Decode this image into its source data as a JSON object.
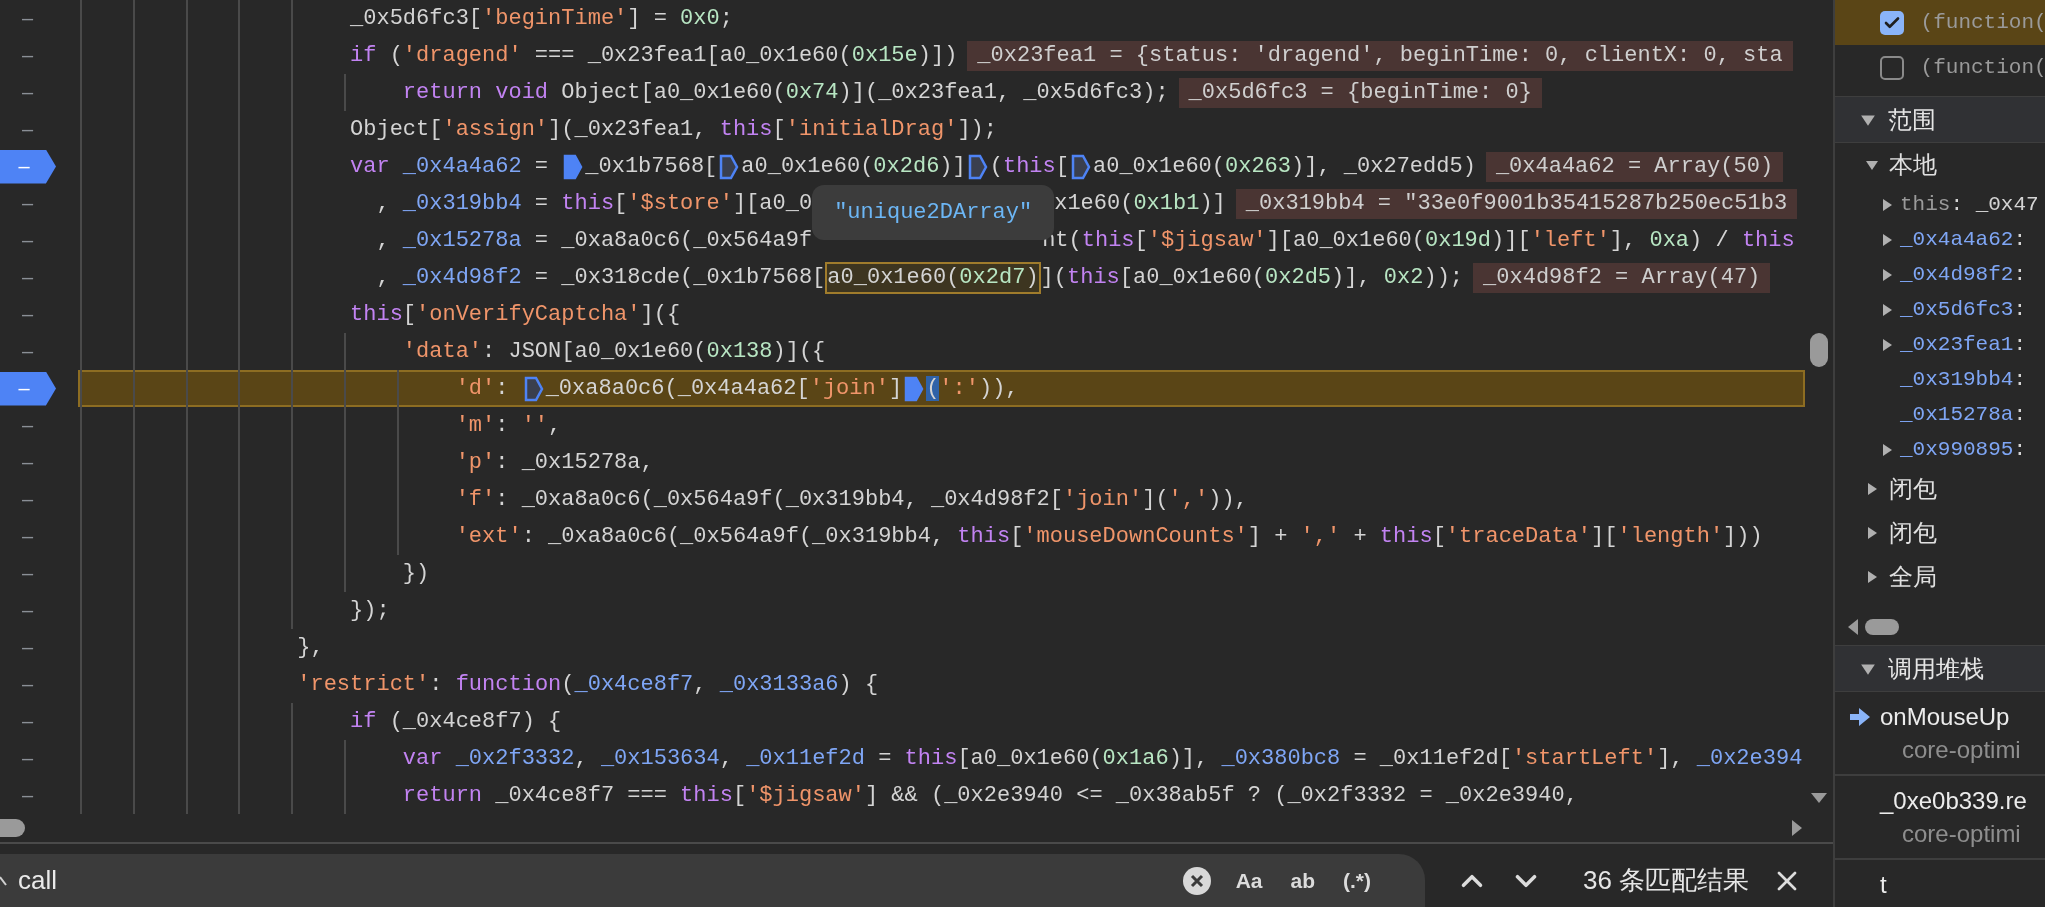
{
  "editor": {
    "lines": [
      {
        "gutter": "–",
        "breakpoint": false,
        "current": false,
        "segments": [
          {
            "kind": "plain",
            "text": "                    _0x5d6fc3["
          },
          {
            "kind": "string",
            "text": "'beginTime'"
          },
          {
            "kind": "plain",
            "text": "] = "
          },
          {
            "kind": "number",
            "text": "0x0"
          },
          {
            "kind": "plain",
            "text": ";"
          }
        ]
      },
      {
        "gutter": "–",
        "breakpoint": false,
        "current": false,
        "segments": [
          {
            "kind": "keyword",
            "text": "                    if"
          },
          {
            "kind": "plain",
            "text": " ("
          },
          {
            "kind": "string",
            "text": "'dragend'"
          },
          {
            "kind": "plain",
            "text": " === _0x23fea1[a0_0x1e60("
          },
          {
            "kind": "number",
            "text": "0x15e"
          },
          {
            "kind": "plain",
            "text": ")])"
          },
          {
            "kind": "value",
            "text": "_0x23fea1 = {status: 'dragend', beginTime: 0, clientX: 0, sta"
          }
        ]
      },
      {
        "gutter": "–",
        "breakpoint": false,
        "current": false,
        "segments": [
          {
            "kind": "keyword",
            "text": "                        return void"
          },
          {
            "kind": "plain",
            "text": " Object[a0_0x1e60("
          },
          {
            "kind": "number",
            "text": "0x74"
          },
          {
            "kind": "plain",
            "text": ")](_0x23fea1, _0x5d6fc3);"
          },
          {
            "kind": "value",
            "text": "_0x5d6fc3 = {beginTime: 0}"
          }
        ]
      },
      {
        "gutter": "–",
        "breakpoint": false,
        "current": false,
        "segments": [
          {
            "kind": "plain",
            "text": "                    Object["
          },
          {
            "kind": "string",
            "text": "'assign'"
          },
          {
            "kind": "plain",
            "text": "](_0x23fea1, "
          },
          {
            "kind": "keyword",
            "text": "this"
          },
          {
            "kind": "plain",
            "text": "["
          },
          {
            "kind": "string",
            "text": "'initialDrag'"
          },
          {
            "kind": "plain",
            "text": "]);"
          }
        ]
      },
      {
        "gutter": "–",
        "breakpoint": true,
        "current": false,
        "segments": [
          {
            "kind": "keyword",
            "text": "                    var "
          },
          {
            "kind": "variable",
            "text": "_0x4a4a62"
          },
          {
            "kind": "plain",
            "text": " = "
          },
          {
            "kind": "marker",
            "filled": true
          },
          {
            "kind": "plain",
            "text": "_0x1b7568["
          },
          {
            "kind": "marker",
            "filled": false
          },
          {
            "kind": "plain",
            "text": "a0_0x1e60("
          },
          {
            "kind": "number",
            "text": "0x2d6"
          },
          {
            "kind": "plain",
            "text": ")]"
          },
          {
            "kind": "marker",
            "filled": false
          },
          {
            "kind": "plain",
            "text": "("
          },
          {
            "kind": "keyword",
            "text": "this"
          },
          {
            "kind": "plain",
            "text": "["
          },
          {
            "kind": "marker",
            "filled": false
          },
          {
            "kind": "plain",
            "text": "a0_0x1e60("
          },
          {
            "kind": "number",
            "text": "0x263"
          },
          {
            "kind": "plain",
            "text": ")], _0x27edd5)"
          },
          {
            "kind": "value",
            "text": "_0x4a4a62 = Array(50)"
          }
        ]
      },
      {
        "gutter": "–",
        "breakpoint": false,
        "current": false,
        "segments": [
          {
            "kind": "plain",
            "text": "                      , "
          },
          {
            "kind": "variable",
            "text": "_0x319bb4"
          },
          {
            "kind": "plain",
            "text": " = "
          },
          {
            "kind": "keyword",
            "text": "this"
          },
          {
            "kind": "plain",
            "text": "["
          },
          {
            "kind": "string",
            "text": "'$store'"
          },
          {
            "kind": "plain",
            "text": "][a0_0"
          },
          {
            "kind": "tooltip",
            "text": "\"unique2DArray\""
          },
          {
            "kind": "plain",
            "text": "x1e60("
          },
          {
            "kind": "number",
            "text": "0x1b1"
          },
          {
            "kind": "plain",
            "text": ")]"
          },
          {
            "kind": "value",
            "text": "_0x319bb4 = \"33e0f9001b35415287b250ec51b3"
          }
        ]
      },
      {
        "gutter": "–",
        "breakpoint": false,
        "current": false,
        "segments": [
          {
            "kind": "plain",
            "text": "                      , "
          },
          {
            "kind": "variable",
            "text": "_0x15278a"
          },
          {
            "kind": "plain",
            "text": " = _0xa8a0c6(_0x564a9f"
          },
          {
            "kind": "covered"
          },
          {
            "kind": "plain",
            "text": "nt("
          },
          {
            "kind": "keyword",
            "text": "this"
          },
          {
            "kind": "plain",
            "text": "["
          },
          {
            "kind": "string",
            "text": "'$jigsaw'"
          },
          {
            "kind": "plain",
            "text": "][a0_0x1e60("
          },
          {
            "kind": "number",
            "text": "0x19d"
          },
          {
            "kind": "plain",
            "text": ")]["
          },
          {
            "kind": "string",
            "text": "'left'"
          },
          {
            "kind": "plain",
            "text": "], "
          },
          {
            "kind": "number",
            "text": "0xa"
          },
          {
            "kind": "plain",
            "text": ") / "
          },
          {
            "kind": "keyword",
            "text": "this"
          }
        ]
      },
      {
        "gutter": "–",
        "breakpoint": false,
        "current": false,
        "segments": [
          {
            "kind": "plain",
            "text": "                      , "
          },
          {
            "kind": "variable",
            "text": "_0x4d98f2"
          },
          {
            "kind": "plain",
            "text": " = _0x318cde(_0x1b7568["
          },
          {
            "kind": "hover",
            "tokens": [
              {
                "kind": "plain",
                "text": "a0_0x1e60("
              },
              {
                "kind": "number",
                "text": "0x2d7"
              },
              {
                "kind": "plain",
                "text": ")"
              }
            ]
          },
          {
            "kind": "plain",
            "text": "]("
          },
          {
            "kind": "keyword",
            "text": "this"
          },
          {
            "kind": "plain",
            "text": "[a0_0x1e60("
          },
          {
            "kind": "number",
            "text": "0x2d5"
          },
          {
            "kind": "plain",
            "text": ")], "
          },
          {
            "kind": "number",
            "text": "0x2"
          },
          {
            "kind": "plain",
            "text": "));"
          },
          {
            "kind": "value",
            "text": "_0x4d98f2 = Array(47)"
          }
        ]
      },
      {
        "gutter": "–",
        "breakpoint": false,
        "current": false,
        "segments": [
          {
            "kind": "keyword",
            "text": "                    this"
          },
          {
            "kind": "plain",
            "text": "["
          },
          {
            "kind": "string",
            "text": "'onVerifyCaptcha'"
          },
          {
            "kind": "plain",
            "text": "]({"
          }
        ]
      },
      {
        "gutter": "–",
        "breakpoint": false,
        "current": false,
        "segments": [
          {
            "kind": "string",
            "text": "                        'data'"
          },
          {
            "kind": "plain",
            "text": ": JSON[a0_0x1e60("
          },
          {
            "kind": "number",
            "text": "0x138"
          },
          {
            "kind": "plain",
            "text": ")]({"
          }
        ]
      },
      {
        "gutter": "–",
        "breakpoint": true,
        "current": true,
        "segments": [
          {
            "kind": "string",
            "text": "                            'd'"
          },
          {
            "kind": "plain",
            "text": ": "
          },
          {
            "kind": "marker",
            "filled": false
          },
          {
            "kind": "plain",
            "text": "_0xa8a0c6(_0x4a4a62["
          },
          {
            "kind": "string",
            "text": "'join'"
          },
          {
            "kind": "plain",
            "text": "]"
          },
          {
            "kind": "marker",
            "filled": true
          },
          {
            "kind": "plain",
            "text": "(",
            "highlight": true
          },
          {
            "kind": "string",
            "text": "':'"
          },
          {
            "kind": "plain",
            "text": ")),"
          }
        ]
      },
      {
        "gutter": "–",
        "breakpoint": false,
        "current": false,
        "segments": [
          {
            "kind": "string",
            "text": "                            'm'"
          },
          {
            "kind": "plain",
            "text": ": "
          },
          {
            "kind": "string",
            "text": "''"
          },
          {
            "kind": "plain",
            "text": ","
          }
        ]
      },
      {
        "gutter": "–",
        "breakpoint": false,
        "current": false,
        "segments": [
          {
            "kind": "string",
            "text": "                            'p'"
          },
          {
            "kind": "plain",
            "text": ": _0x15278a,"
          }
        ]
      },
      {
        "gutter": "–",
        "breakpoint": false,
        "current": false,
        "segments": [
          {
            "kind": "string",
            "text": "                            'f'"
          },
          {
            "kind": "plain",
            "text": ": _0xa8a0c6(_0x564a9f(_0x319bb4, _0x4d98f2["
          },
          {
            "kind": "string",
            "text": "'join'"
          },
          {
            "kind": "plain",
            "text": "]("
          },
          {
            "kind": "string",
            "text": "','"
          },
          {
            "kind": "plain",
            "text": ")),"
          }
        ]
      },
      {
        "gutter": "–",
        "breakpoint": false,
        "current": false,
        "segments": [
          {
            "kind": "string",
            "text": "                            'ext'"
          },
          {
            "kind": "plain",
            "text": ": _0xa8a0c6(_0x564a9f(_0x319bb4, "
          },
          {
            "kind": "keyword",
            "text": "this"
          },
          {
            "kind": "plain",
            "text": "["
          },
          {
            "kind": "string",
            "text": "'mouseDownCounts'"
          },
          {
            "kind": "plain",
            "text": "] + "
          },
          {
            "kind": "string",
            "text": "','"
          },
          {
            "kind": "plain",
            "text": " + "
          },
          {
            "kind": "keyword",
            "text": "this"
          },
          {
            "kind": "plain",
            "text": "["
          },
          {
            "kind": "string",
            "text": "'traceData'"
          },
          {
            "kind": "plain",
            "text": "]["
          },
          {
            "kind": "string",
            "text": "'length'"
          },
          {
            "kind": "plain",
            "text": "]))"
          }
        ]
      },
      {
        "gutter": "–",
        "breakpoint": false,
        "current": false,
        "segments": [
          {
            "kind": "plain",
            "text": "                        })"
          }
        ]
      },
      {
        "gutter": "–",
        "breakpoint": false,
        "current": false,
        "segments": [
          {
            "kind": "plain",
            "text": "                    });"
          }
        ]
      },
      {
        "gutter": "–",
        "breakpoint": false,
        "current": false,
        "segments": [
          {
            "kind": "plain",
            "text": "                },"
          }
        ]
      },
      {
        "gutter": "–",
        "breakpoint": false,
        "current": false,
        "segments": [
          {
            "kind": "string",
            "text": "                'restrict'"
          },
          {
            "kind": "plain",
            "text": ": "
          },
          {
            "kind": "keyword",
            "text": "function"
          },
          {
            "kind": "plain",
            "text": "("
          },
          {
            "kind": "variable",
            "text": "_0x4ce8f7"
          },
          {
            "kind": "plain",
            "text": ", "
          },
          {
            "kind": "variable",
            "text": "_0x3133a6"
          },
          {
            "kind": "plain",
            "text": ") {"
          }
        ]
      },
      {
        "gutter": "–",
        "breakpoint": false,
        "current": false,
        "segments": [
          {
            "kind": "keyword",
            "text": "                    if"
          },
          {
            "kind": "plain",
            "text": " (_0x4ce8f7) {"
          }
        ]
      },
      {
        "gutter": "–",
        "breakpoint": false,
        "current": false,
        "segments": [
          {
            "kind": "keyword",
            "text": "                        var "
          },
          {
            "kind": "variable",
            "text": "_0x2f3332"
          },
          {
            "kind": "plain",
            "text": ", "
          },
          {
            "kind": "variable",
            "text": "_0x153634"
          },
          {
            "kind": "plain",
            "text": ", "
          },
          {
            "kind": "variable",
            "text": "_0x11ef2d"
          },
          {
            "kind": "plain",
            "text": " = "
          },
          {
            "kind": "keyword",
            "text": "this"
          },
          {
            "kind": "plain",
            "text": "[a0_0x1e60("
          },
          {
            "kind": "number",
            "text": "0x1a6"
          },
          {
            "kind": "plain",
            "text": ")], "
          },
          {
            "kind": "variable",
            "text": "_0x380bc8"
          },
          {
            "kind": "plain",
            "text": " = _0x11ef2d["
          },
          {
            "kind": "string",
            "text": "'startLeft'"
          },
          {
            "kind": "plain",
            "text": "], "
          },
          {
            "kind": "variable",
            "text": "_0x2e394"
          }
        ]
      },
      {
        "gutter": "–",
        "breakpoint": false,
        "current": false,
        "segments": [
          {
            "kind": "keyword",
            "text": "                        return"
          },
          {
            "kind": "plain",
            "text": " _0x4ce8f7 === "
          },
          {
            "kind": "keyword",
            "text": "this"
          },
          {
            "kind": "plain",
            "text": "["
          },
          {
            "kind": "string",
            "text": "'$jigsaw'"
          },
          {
            "kind": "plain",
            "text": "] && (_0x2e3940 <= _0x38ab5f ? (_0x2f3332 = _0x2e3940,"
          }
        ]
      }
    ]
  },
  "search": {
    "query": "call",
    "options": [
      {
        "label": "Aa"
      },
      {
        "label": "ab"
      },
      {
        "label": "(.*)"
      }
    ],
    "result": "36 条匹配结果"
  },
  "sidebar": {
    "breakpoints": [
      {
        "label": "(function(",
        "checked": true,
        "selected": true
      },
      {
        "label": "(function(",
        "checked": false,
        "selected": false
      }
    ],
    "scope": {
      "title": "范围",
      "expanded": true,
      "groups": [
        {
          "label": "本地",
          "expanded": true,
          "children": [
            {
              "name": "this",
              "value": ": _0x47",
              "kind": "object",
              "dim": true
            },
            {
              "name": "_0x4a4a62",
              "value": ":",
              "kind": "object"
            },
            {
              "name": "_0x4d98f2",
              "value": ":",
              "kind": "object"
            },
            {
              "name": "_0x5d6fc3",
              "value": ":",
              "kind": "object"
            },
            {
              "name": "_0x23fea1",
              "value": ":",
              "kind": "object"
            },
            {
              "name": "_0x319bb4",
              "value": ":",
              "kind": "primitive"
            },
            {
              "name": "_0x15278a",
              "value": ":",
              "kind": "primitive"
            },
            {
              "name": "_0x990895",
              "value": ":",
              "kind": "object"
            }
          ]
        },
        {
          "label": "闭包",
          "expanded": false
        },
        {
          "label": "闭包",
          "expanded": false
        },
        {
          "label": "全局",
          "expanded": false
        }
      ]
    },
    "call_stack": {
      "title": "调用堆栈",
      "expanded": true,
      "frames": [
        {
          "name": "onMouseUp",
          "file": "core-optimi",
          "current": true
        },
        {
          "name": "_0xe0b339.re",
          "file": "core-optimi",
          "current": false
        },
        {
          "name": "t",
          "current": false
        }
      ]
    }
  }
}
